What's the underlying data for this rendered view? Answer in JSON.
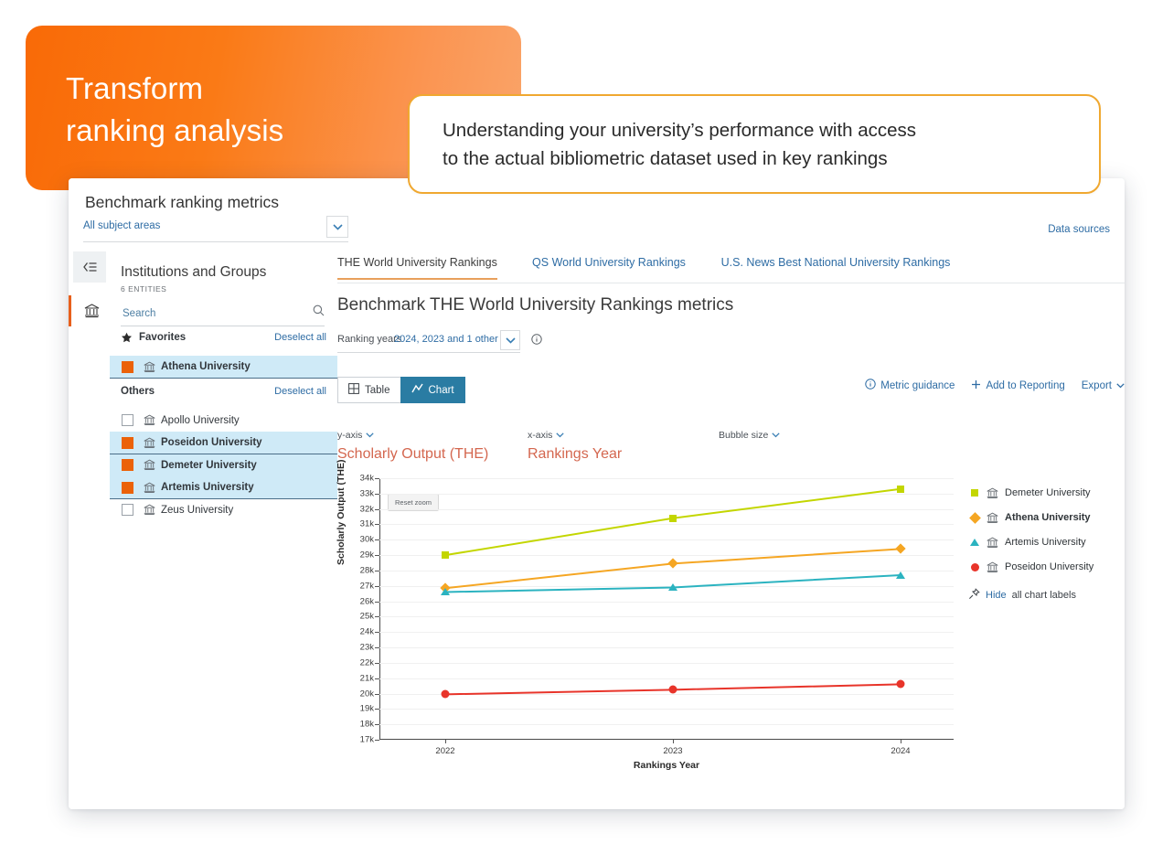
{
  "hero": {
    "line1": "Transform",
    "line2": "ranking analysis"
  },
  "callout": {
    "line1": "Understanding your university’s performance with access",
    "line2": "to the actual bibliometric dataset used in key rankings"
  },
  "app": {
    "title": "Benchmark ranking metrics",
    "subject_filter": "All subject areas",
    "source_tag": "THE",
    "data_sources_link": "Data sources"
  },
  "panel": {
    "title": "Institutions and Groups",
    "count": "6 ENTITIES",
    "search_placeholder": "Search",
    "groups": [
      {
        "label": "Favorites",
        "deselect": "Deselect all",
        "items": [
          {
            "name": "Athena University",
            "checked": true,
            "selected": true
          }
        ]
      },
      {
        "label": "Others",
        "deselect": "Deselect all",
        "items": [
          {
            "name": "Apollo University",
            "checked": false,
            "selected": false
          },
          {
            "name": "Poseidon University",
            "checked": true,
            "selected": true
          },
          {
            "name": "Demeter University",
            "checked": true,
            "selected": true
          },
          {
            "name": "Artemis University",
            "checked": true,
            "selected": true
          },
          {
            "name": "Zeus University",
            "checked": false,
            "selected": false
          }
        ]
      }
    ]
  },
  "tabs": [
    {
      "label": "THE World University Rankings",
      "active": true
    },
    {
      "label": "QS World University Rankings",
      "active": false
    },
    {
      "label": "U.S. News Best National University Rankings",
      "active": false
    }
  ],
  "main": {
    "heading": "Benchmark THE World University Rankings metrics",
    "ranking_years_label": "Ranking years",
    "ranking_years_value": "2024, 2023 and 1 other",
    "view_table": "Table",
    "view_chart": "Chart",
    "active_view": "Chart",
    "metric_guidance": "Metric guidance",
    "add_to_reporting": "Add to Reporting",
    "export": "Export"
  },
  "axis_selectors": {
    "y_key": "y-axis",
    "y_value": "Scholarly Output (THE)",
    "x_key": "x-axis",
    "x_value": "Rankings Year",
    "bubble_key": "Bubble size"
  },
  "chart_controls": {
    "reset_zoom": "Reset zoom",
    "hide_link": "Hide",
    "hide_rest": "all chart labels"
  },
  "colors": {
    "brand_orange": "#eb6209",
    "link_blue": "#2e6ca4",
    "toggle_active": "#2a7ca3",
    "axis_value": "#d4674f",
    "callout_border": "#f0a830",
    "demeter": "#c3d600",
    "athena": "#f5a623",
    "artemis": "#2bb3c0",
    "poseidon": "#e8342a"
  },
  "chart_data": {
    "type": "line",
    "title": "",
    "xlabel": "Rankings Year",
    "ylabel": "Scholarly Output (THE)",
    "x": [
      "2022",
      "2023",
      "2024"
    ],
    "ylim": [
      17000,
      34000
    ],
    "ytick_labels": [
      "17k",
      "18k",
      "19k",
      "20k",
      "21k",
      "22k",
      "23k",
      "24k",
      "25k",
      "26k",
      "27k",
      "28k",
      "29k",
      "30k",
      "31k",
      "32k",
      "33k",
      "34k"
    ],
    "ytick_values": [
      17000,
      18000,
      19000,
      20000,
      21000,
      22000,
      23000,
      24000,
      25000,
      26000,
      27000,
      28000,
      29000,
      30000,
      31000,
      32000,
      33000,
      34000
    ],
    "grid": true,
    "legend_position": "right",
    "series": [
      {
        "name": "Demeter University",
        "values": [
          29000,
          31400,
          33300
        ],
        "color": "#c3d600",
        "marker": "square"
      },
      {
        "name": "Athena University",
        "values": [
          26850,
          28450,
          29400
        ],
        "color": "#f5a623",
        "marker": "diamond"
      },
      {
        "name": "Artemis University",
        "values": [
          26600,
          26900,
          27700
        ],
        "color": "#2bb3c0",
        "marker": "triangle"
      },
      {
        "name": "Poseidon University",
        "values": [
          19950,
          20250,
          20600
        ],
        "color": "#e8342a",
        "marker": "circle"
      }
    ]
  }
}
